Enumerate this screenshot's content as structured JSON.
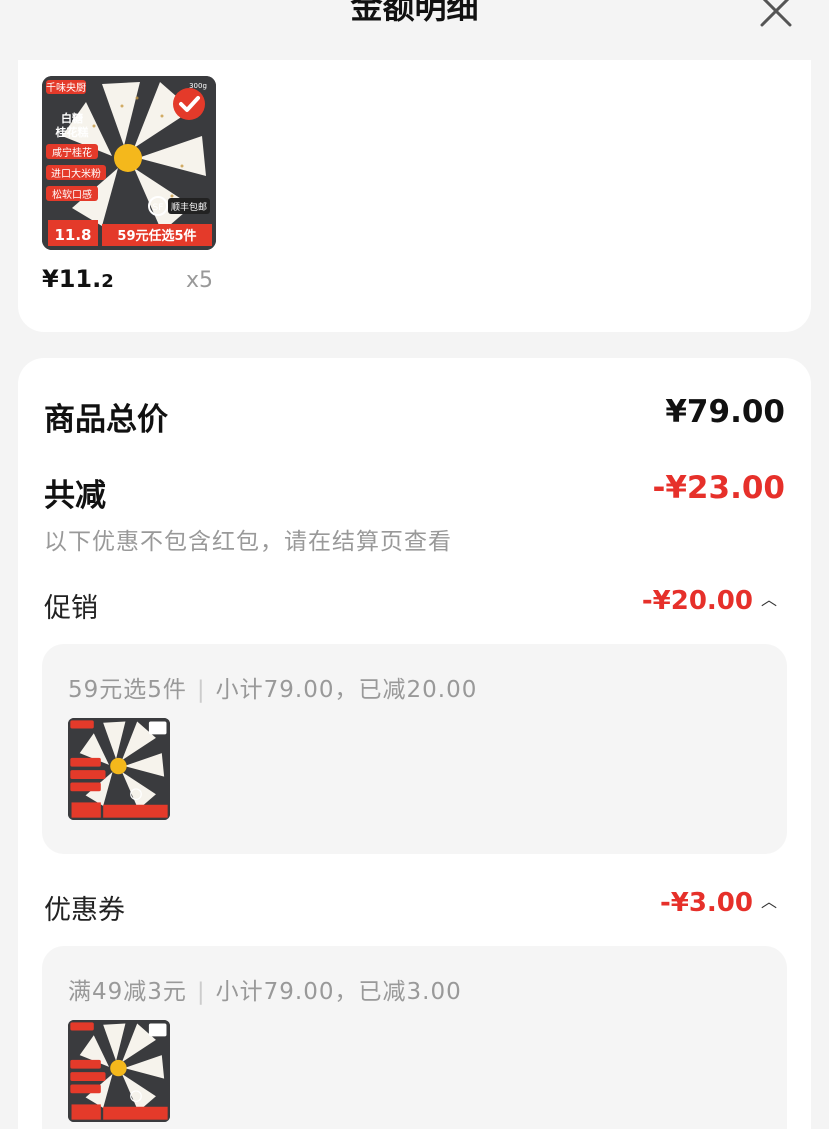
{
  "header": {
    "title": "金额明细"
  },
  "product": {
    "price_main": "¥11.",
    "price_decimal": "2",
    "quantity": "x5",
    "thumb_brand": "千味央厨",
    "thumb_name_1": "白糖",
    "thumb_name_2": "桂花糕",
    "thumb_tags": [
      "咸宁桂花",
      "进口大米粉",
      "松软口感"
    ],
    "thumb_price": "11.8",
    "thumb_promo": "59元任选5件",
    "thumb_shipping": "顺丰包邮",
    "thumb_weight": "300g"
  },
  "summary": {
    "total_label": "商品总价",
    "total_value": "¥79.00",
    "discount_label": "共减",
    "discount_value": "-¥23.00",
    "note": "以下优惠不包含红包，请在结算页查看"
  },
  "promotion": {
    "label": "促销",
    "value": "-¥20.00",
    "rule": "59元选5件",
    "detail": "小计79.00，已减20.00"
  },
  "coupon": {
    "label": "优惠券",
    "value": "-¥3.00",
    "rule": "满49减3元",
    "detail": "小计79.00，已减3.00"
  },
  "colors": {
    "accent_red": "#e6302a",
    "background": "#f4f4f4"
  }
}
